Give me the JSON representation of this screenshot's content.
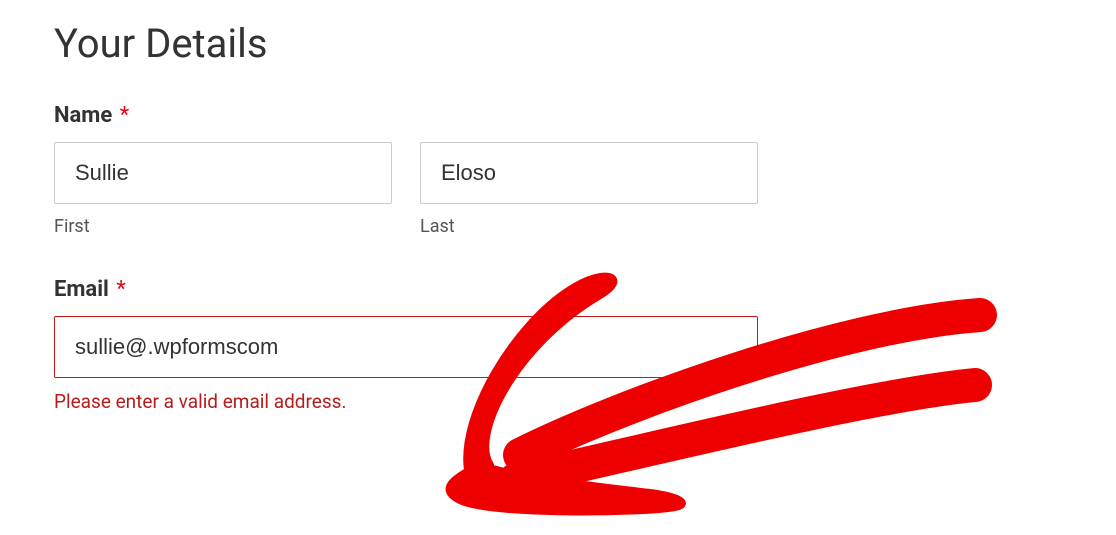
{
  "form": {
    "title": "Your Details",
    "name": {
      "label": "Name",
      "required": "*",
      "first": {
        "value": "Sullie",
        "sublabel": "First"
      },
      "last": {
        "value": "Eloso",
        "sublabel": "Last"
      }
    },
    "email": {
      "label": "Email",
      "required": "*",
      "value": "sullie@.wpformscom",
      "error": "Please enter a valid email address."
    }
  }
}
